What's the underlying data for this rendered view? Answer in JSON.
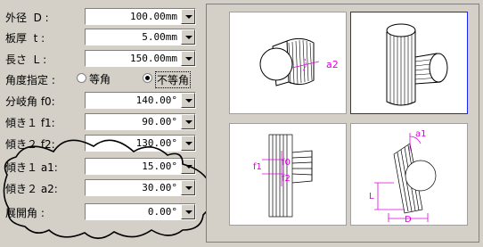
{
  "fields": [
    {
      "label": "外径  D :",
      "value": "100.00mm"
    },
    {
      "label": "板厚  t :",
      "value": "5.00mm"
    },
    {
      "label": "長さ  L :",
      "value": "150.00mm"
    }
  ],
  "angle_mode": {
    "label": "角度指定 :",
    "equal": "等角",
    "unequal": "不等角",
    "selected": "unequal"
  },
  "angles": [
    {
      "label": "分岐角 f0:",
      "value": "140.00°"
    },
    {
      "label": "傾き１ f1:",
      "value": "90.00°"
    },
    {
      "label": "傾き２ f2:",
      "value": "130.00°"
    },
    {
      "label": "傾き１ a1:",
      "value": "15.00°"
    },
    {
      "label": "傾き２ a2:",
      "value": "30.00°"
    },
    {
      "label": "展開角 :",
      "value": "0.00°"
    }
  ],
  "views": {
    "top_dim": "a2",
    "front_dims": [
      "f1",
      "f0",
      "f2"
    ],
    "side_dims": [
      "a1",
      "L",
      "D"
    ]
  }
}
